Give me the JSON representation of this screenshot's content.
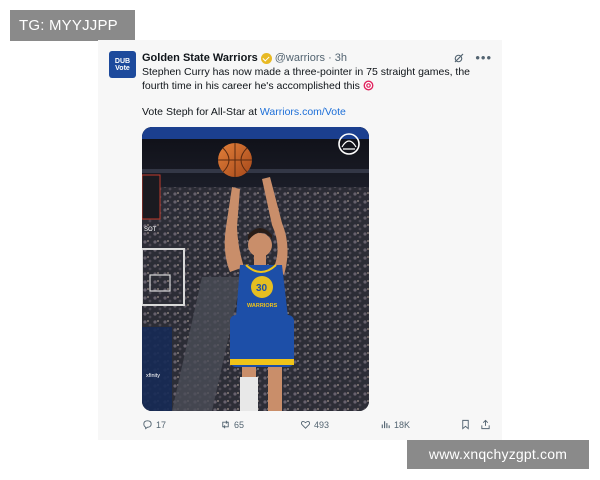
{
  "watermark_top": "TG: MYYJJPP",
  "watermark_bottom": "www.xnqchyzgpt.com",
  "tweet": {
    "author_name": "Golden State Warriors",
    "handle_time": "@warriors · 3h",
    "avatar_text_1": "DUB",
    "avatar_text_2": "Vote",
    "text_line_1": "Stephen Curry has now made a three-pointer in 75 straight games, the",
    "text_line_2": "fourth time in his career he's accomplished this",
    "vote_prefix": "Vote Steph for All-Star at ",
    "vote_link": "Warriors.com/Vote",
    "jersey_number": "30",
    "jersey_text": "WARRIORS",
    "court_sign": "SOT",
    "court_sign_2": "xfinity",
    "actions": {
      "replies": "17",
      "reposts": "65",
      "likes": "493",
      "views": "18K"
    }
  },
  "colors": {
    "link": "#1d6fd8",
    "avatar_bg": "#1d4a9c",
    "verified": "#e8b923",
    "jersey": "#1d4fa8",
    "jersey_trim": "#f0c419"
  },
  "icons": [
    "grok-icon",
    "more-icon",
    "target-icon",
    "warriors-logo-icon",
    "reply-icon",
    "repost-icon",
    "like-icon",
    "views-icon",
    "bookmark-icon",
    "share-icon"
  ]
}
